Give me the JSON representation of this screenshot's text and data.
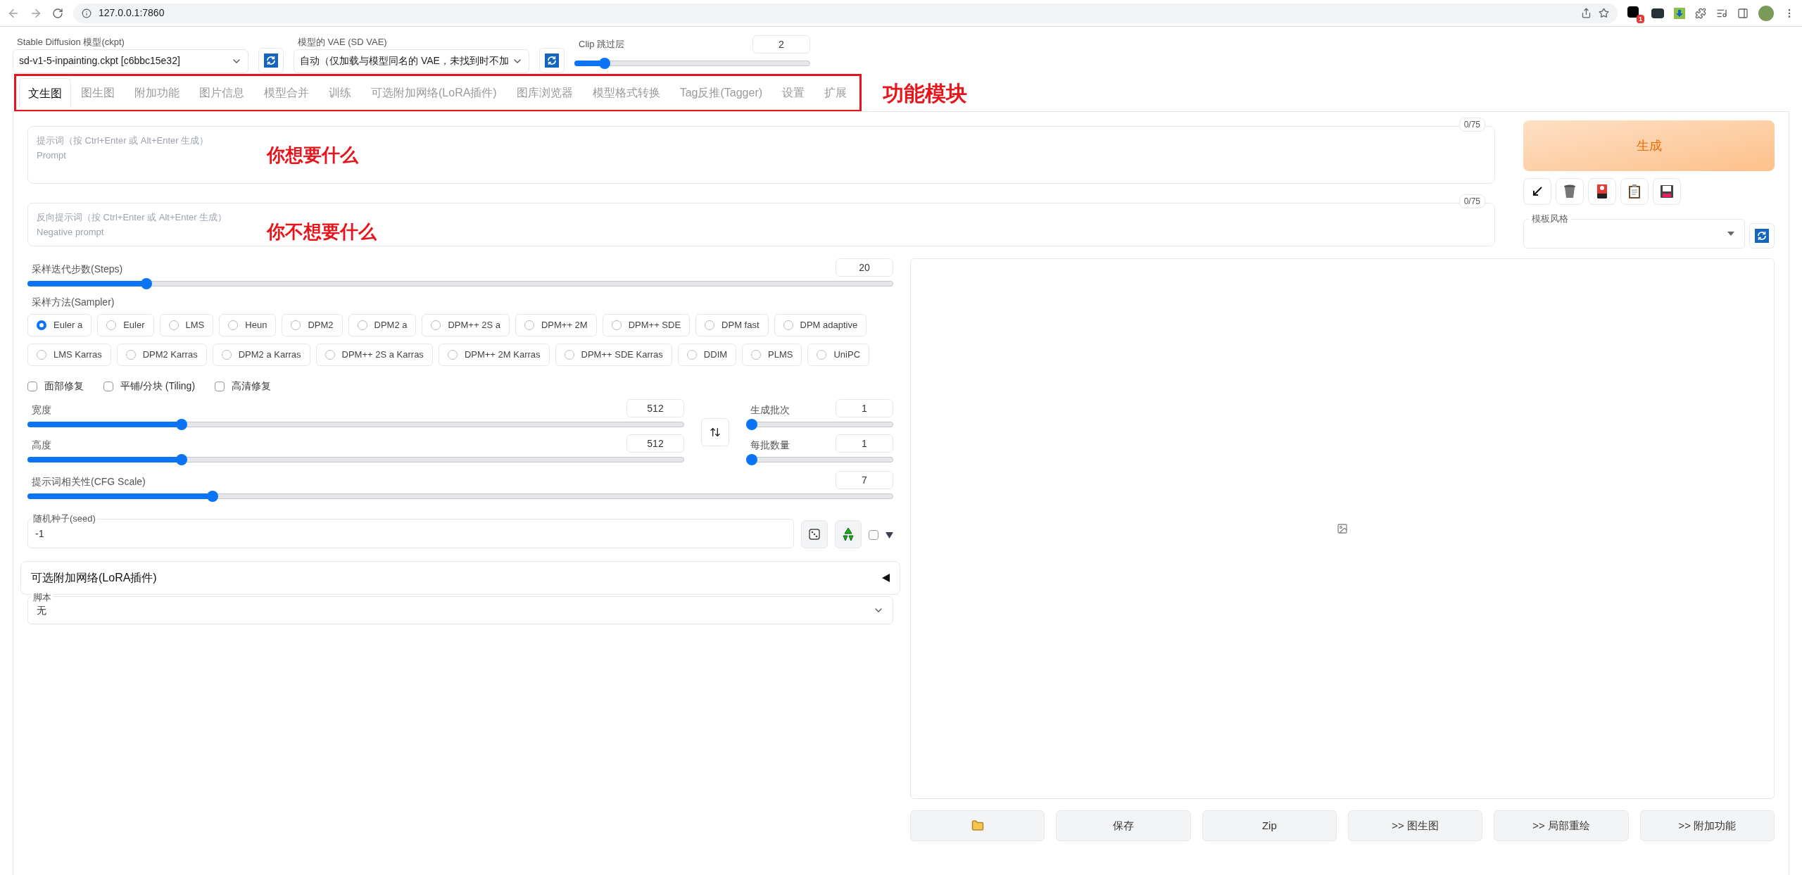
{
  "browser": {
    "url": "127.0.0.1:7860",
    "extension_badge": "1"
  },
  "settings": {
    "checkpoint": {
      "label": "Stable Diffusion 模型(ckpt)",
      "value": "sd-v1-5-inpainting.ckpt [c6bbc15e32]"
    },
    "vae": {
      "label": "模型的 VAE (SD VAE)",
      "value": "自动（仅加载与模型同名的 VAE，未找到时不加"
    },
    "clip": {
      "label": "Clip 跳过层",
      "value": "2",
      "level": 0.11
    }
  },
  "tabs": [
    {
      "label": "文生图",
      "selected": true
    },
    {
      "label": "图生图",
      "selected": false
    },
    {
      "label": "附加功能",
      "selected": false
    },
    {
      "label": "图片信息",
      "selected": false
    },
    {
      "label": "模型合并",
      "selected": false
    },
    {
      "label": "训练",
      "selected": false
    },
    {
      "label": "可选附加网络(LoRA插件)",
      "selected": false
    },
    {
      "label": "图库浏览器",
      "selected": false
    },
    {
      "label": "模型格式转换",
      "selected": false
    },
    {
      "label": "Tag反推(Tagger)",
      "selected": false
    },
    {
      "label": "设置",
      "selected": false
    },
    {
      "label": "扩展",
      "selected": false
    }
  ],
  "annotations": {
    "tabs_note": "功能模块",
    "prompt_note": "你想要什么",
    "negative_note": "你不想要什么"
  },
  "prompt": {
    "placeholder": "提示词（按 Ctrl+Enter 或 Alt+Enter 生成）\nPrompt",
    "counter": "0/75"
  },
  "negative_prompt": {
    "placeholder": "反向提示词（按 Ctrl+Enter 或 Alt+Enter 生成）\nNegative prompt",
    "counter": "0/75"
  },
  "generate_button": "生成",
  "styles": {
    "label": "模板风格"
  },
  "steps": {
    "label": "采样迭代步数(Steps)",
    "value": "20",
    "level": 0.133
  },
  "sampler": {
    "label": "采样方法(Sampler)",
    "options": [
      {
        "label": "Euler a",
        "selected": true
      },
      {
        "label": "Euler",
        "selected": false
      },
      {
        "label": "LMS",
        "selected": false
      },
      {
        "label": "Heun",
        "selected": false
      },
      {
        "label": "DPM2",
        "selected": false
      },
      {
        "label": "DPM2 a",
        "selected": false
      },
      {
        "label": "DPM++ 2S a",
        "selected": false
      },
      {
        "label": "DPM++ 2M",
        "selected": false
      },
      {
        "label": "DPM++ SDE",
        "selected": false
      },
      {
        "label": "DPM fast",
        "selected": false
      },
      {
        "label": "DPM adaptive",
        "selected": false
      },
      {
        "label": "LMS Karras",
        "selected": false
      },
      {
        "label": "DPM2 Karras",
        "selected": false
      },
      {
        "label": "DPM2 a Karras",
        "selected": false
      },
      {
        "label": "DPM++ 2S a Karras",
        "selected": false
      },
      {
        "label": "DPM++ 2M Karras",
        "selected": false
      },
      {
        "label": "DPM++ SDE Karras",
        "selected": false
      },
      {
        "label": "DDIM",
        "selected": false
      },
      {
        "label": "PLMS",
        "selected": false
      },
      {
        "label": "UniPC",
        "selected": false
      }
    ]
  },
  "options": [
    {
      "label": "面部修复",
      "checked": false
    },
    {
      "label": "平铺/分块 (Tiling)",
      "checked": false
    },
    {
      "label": "高清修复",
      "checked": false
    }
  ],
  "width": {
    "label": "宽度",
    "value": "512",
    "level": 0.23
  },
  "height": {
    "label": "高度",
    "value": "512",
    "level": 0.23
  },
  "batch_count": {
    "label": "生成批次",
    "value": "1",
    "level": 0
  },
  "batch_size": {
    "label": "每批数量",
    "value": "1",
    "level": 0
  },
  "cfg": {
    "label": "提示词相关性(CFG Scale)",
    "value": "7",
    "level": 0.21
  },
  "seed": {
    "label": "随机种子(seed)",
    "value": "-1",
    "extra_checked": false
  },
  "lora_panel": {
    "title": "可选附加网络(LoRA插件)",
    "expanded": false
  },
  "script": {
    "label": "脚本",
    "value": "无"
  },
  "output_buttons": [
    {
      "kind": "folder"
    },
    {
      "kind": "text",
      "label": "保存"
    },
    {
      "kind": "text",
      "label": "Zip"
    },
    {
      "kind": "text",
      "label": ">> 图生图"
    },
    {
      "kind": "text",
      "label": ">> 局部重绘"
    },
    {
      "kind": "text",
      "label": ">> 附加功能"
    }
  ]
}
